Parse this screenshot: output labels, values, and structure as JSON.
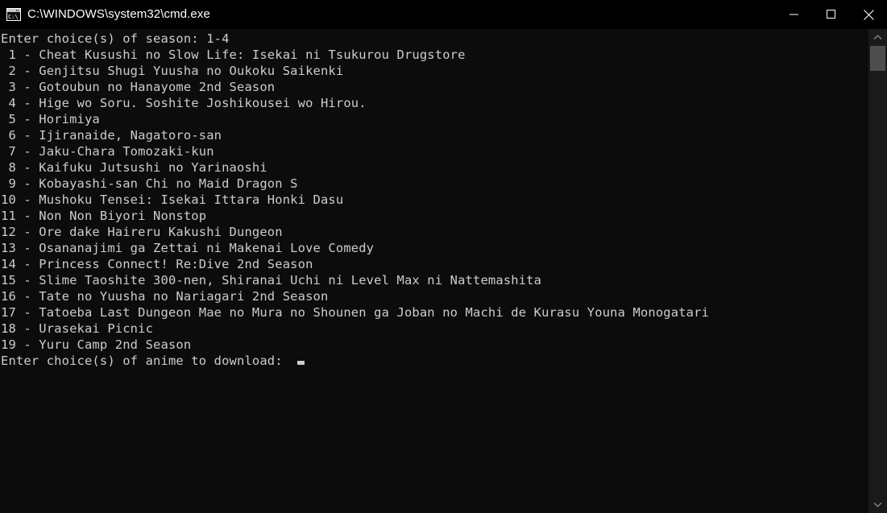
{
  "window": {
    "title": "C:\\WINDOWS\\system32\\cmd.exe",
    "icon": "cmd-console-icon",
    "background_color": "#0c0c0c",
    "text_color": "#cccccc",
    "titlebar_color": "#000000",
    "controls": {
      "minimize": "minimize-icon",
      "maximize": "maximize-icon",
      "close": "close-icon"
    }
  },
  "console": {
    "header": "Enter choice(s) of season: 1-4",
    "lines": [
      " 1 - Cheat Kusushi no Slow Life: Isekai ni Tsukurou Drugstore",
      " 2 - Genjitsu Shugi Yuusha no Oukoku Saikenki",
      " 3 - Gotoubun no Hanayome 2nd Season",
      " 4 - Hige wo Soru. Soshite Joshikousei wo Hirou.",
      " 5 - Horimiya",
      " 6 - Ijiranaide, Nagatoro-san",
      " 7 - Jaku-Chara Tomozaki-kun",
      " 8 - Kaifuku Jutsushi no Yarinaoshi",
      " 9 - Kobayashi-san Chi no Maid Dragon S",
      "10 - Mushoku Tensei: Isekai Ittara Honki Dasu",
      "11 - Non Non Biyori Nonstop",
      "12 - Ore dake Haireru Kakushi Dungeon",
      "13 - Osananajimi ga Zettai ni Makenai Love Comedy",
      "14 - Princess Connect! Re:Dive 2nd Season",
      "15 - Slime Taoshite 300-nen, Shiranai Uchi ni Level Max ni Nattemashita",
      "16 - Tate no Yuusha no Nariagari 2nd Season",
      "17 - Tatoeba Last Dungeon Mae no Mura no Shounen ga Joban no Machi de Kurasu Youna Monogatari",
      "18 - Urasekai Picnic",
      "19 - Yuru Camp 2nd Season"
    ],
    "prompt": "Enter choice(s) of anime to download: ",
    "input_value": "",
    "cursor": "block-cursor"
  },
  "scrollbar": {
    "up_arrow": "chevron-up-icon",
    "down_arrow": "chevron-down-icon",
    "thumb": "scrollbar-thumb",
    "track_color": "#1a1a1a",
    "thumb_color": "#4e4e4e"
  }
}
